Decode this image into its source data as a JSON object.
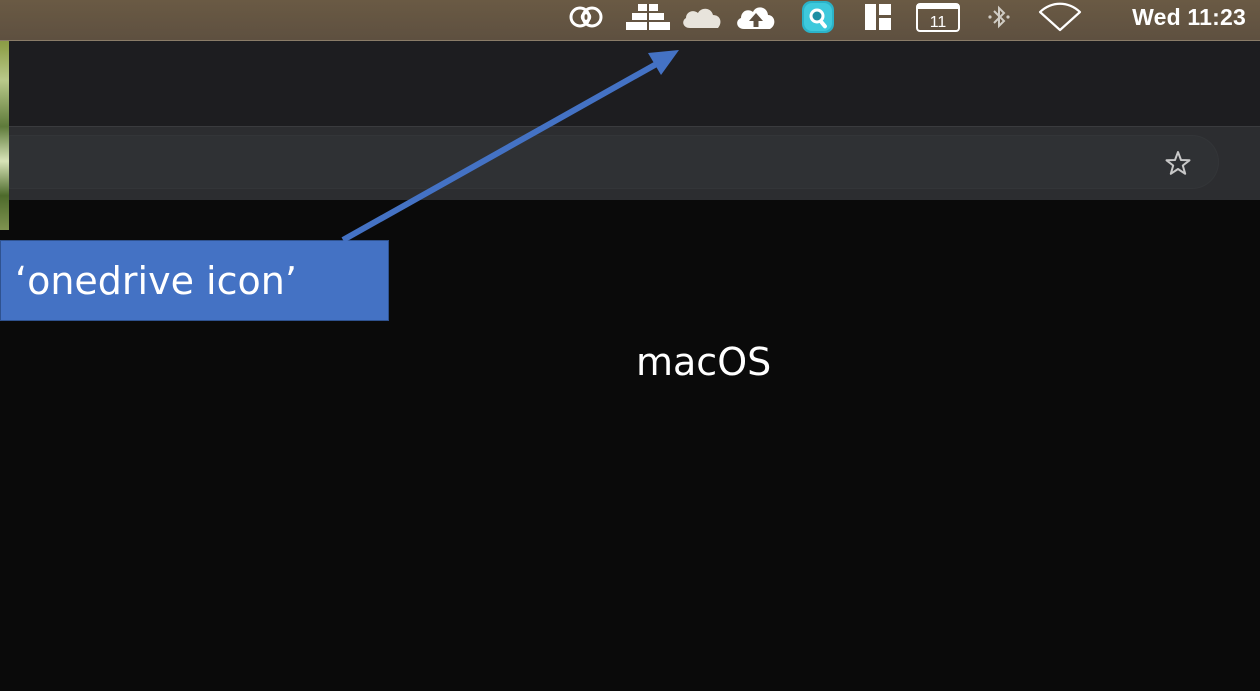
{
  "menubar": {
    "clock": "Wed 11:23",
    "calendar_day": "11",
    "icons": [
      "creative-cloud-icon",
      "parallels-icon",
      "onedrive-icon",
      "cloud-upload-icon",
      "quicklook-search-icon",
      "window-manager-icon",
      "calendar-icon",
      "bluetooth-icon",
      "wifi-icon"
    ]
  },
  "toolbar": {
    "bookmark_icon": "star-icon"
  },
  "annotation": {
    "callout_text": "‘onedrive icon’",
    "callout_color": "#4472c4",
    "arrow_color": "#4472c4"
  },
  "main": {
    "os_label": "macOS"
  }
}
